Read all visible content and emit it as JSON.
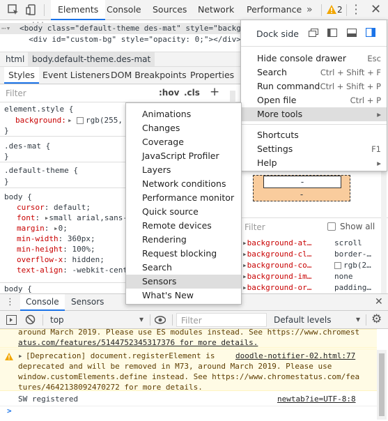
{
  "toolbar": {
    "tabs": [
      "Elements",
      "Console",
      "Sources",
      "Network",
      "Performance"
    ],
    "more_tabs": "»",
    "warning_count": "2"
  },
  "dom": {
    "line1": "<body class=\"default-theme des-mat\" style=\"backg",
    "line2": "  <div id=\"custom-bg\" style=\"opacity: 0;\"></div>",
    "line3": "    ..."
  },
  "breadcrumbs": [
    "html",
    "body.default-theme.des-mat"
  ],
  "subtabs": [
    "Styles",
    "Event Listeners",
    "DOM Breakpoints",
    "Properties"
  ],
  "filter": {
    "placeholder": "Filter",
    "hov": ":hov",
    "cls": ".cls",
    "add": "+"
  },
  "styles": {
    "element_style": "element.style {",
    "element_prop": "background:",
    "element_val": "rgb(255,",
    "close": "}",
    "des_mat": ".des-mat {",
    "default_theme": ".default-theme {",
    "body": "body {",
    "body_props": [
      {
        "name": "cursor",
        "value": "default;"
      },
      {
        "name": "font",
        "value": "small arial,sans-"
      },
      {
        "name": "margin",
        "value": "0;"
      },
      {
        "name": "min-width",
        "value": "360px;"
      },
      {
        "name": "min-height",
        "value": "100%;"
      },
      {
        "name": "overflow-x",
        "value": "hidden;"
      },
      {
        "name": "text-align",
        "value": "-webkit-cent"
      }
    ],
    "body2": "body {"
  },
  "computed": {
    "filter_placeholder": "Filter",
    "show_all": "Show all",
    "box_dash1": "-",
    "box_dash2": "-",
    "props": [
      {
        "name": "background-at…",
        "value": "scroll"
      },
      {
        "name": "background-cl…",
        "value": "border-…"
      },
      {
        "name": "background-co…",
        "value": "rgb(2…"
      },
      {
        "name": "background-im…",
        "value": "none"
      },
      {
        "name": "background-or…",
        "value": "padding…"
      }
    ]
  },
  "drawer": {
    "tabs": [
      "Console",
      "Sensors"
    ],
    "context": "top",
    "filter_placeholder": "Filter",
    "levels": "Default levels"
  },
  "console": {
    "msg1_line1": "around March 2019. Please use ES modules instead. See https://www.chromest",
    "msg1_line2": "atus.com/features/5144752345317376 for more details.",
    "msg2_line1": "[Deprecation] document.registerElement is",
    "msg2_source": "doodle-notifier-02.html:77",
    "msg2_line2": "deprecated and will be removed in M73, around March 2019. Please use",
    "msg2_line3": "window.customElements.define instead. See https://www.chromestatus.com/fea",
    "msg2_line4": "tures/4642138092470272 for more details.",
    "msg3": "SW registered",
    "msg3_source": "newtab?ie=UTF-8:8",
    "prompt": ">"
  },
  "main_menu": {
    "dock_side": "Dock side",
    "items": [
      {
        "label": "Hide console drawer",
        "shortcut": "Esc"
      },
      {
        "label": "Search",
        "shortcut": "Ctrl + Shift + F"
      },
      {
        "label": "Run command",
        "shortcut": "Ctrl + Shift + P"
      },
      {
        "label": "Open file",
        "shortcut": "Ctrl + P"
      },
      {
        "label": "More tools",
        "shortcut": "▸"
      },
      {
        "label": "Shortcuts",
        "shortcut": ""
      },
      {
        "label": "Settings",
        "shortcut": "F1"
      },
      {
        "label": "Help",
        "shortcut": "▸"
      }
    ]
  },
  "more_tools_menu": {
    "items": [
      "Animations",
      "Changes",
      "Coverage",
      "JavaScript Profiler",
      "Layers",
      "Network conditions",
      "Performance monitor",
      "Quick source",
      "Remote devices",
      "Rendering",
      "Request blocking",
      "Search",
      "Sensors",
      "What's New"
    ],
    "highlighted": "Sensors"
  },
  "colors": {
    "accent": "#1a73e8",
    "warning": "#f2a600",
    "box_model_margin": "#f9cc9d"
  }
}
